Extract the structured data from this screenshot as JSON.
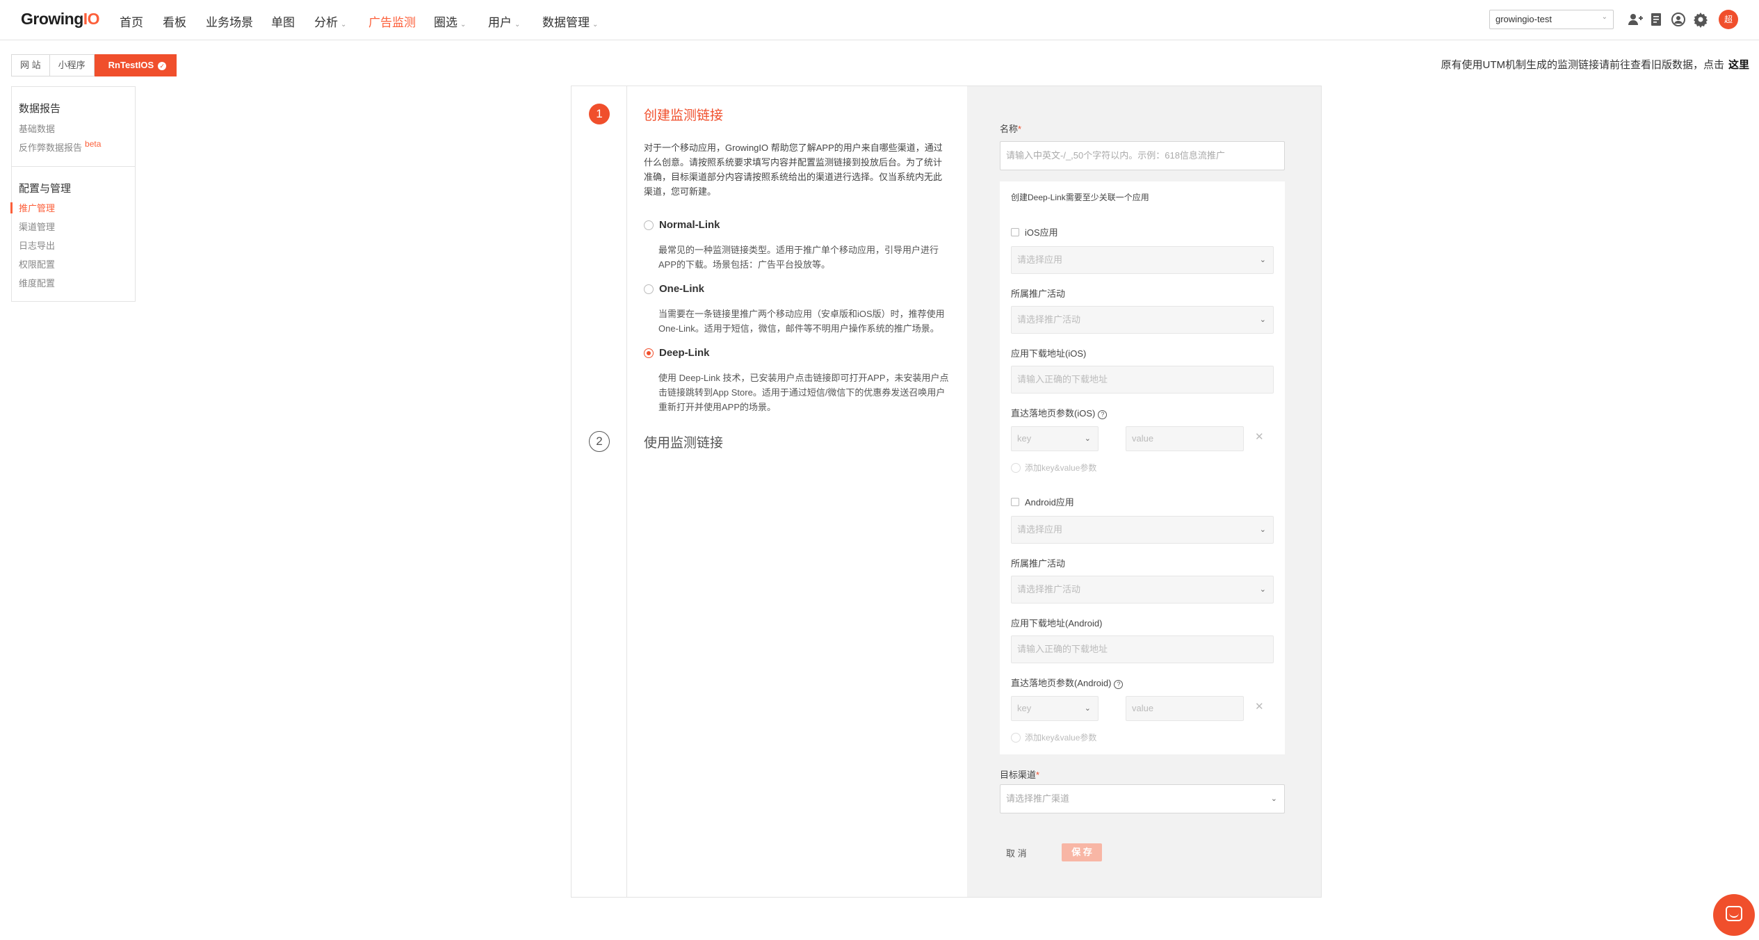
{
  "brand": {
    "logo_text": "Growing",
    "logo_accent": "IO",
    "accent_color": "#f04f2c"
  },
  "nav": {
    "items": [
      {
        "label": "首页",
        "has_caret": false
      },
      {
        "label": "看板",
        "has_caret": false
      },
      {
        "label": "业务场景",
        "has_caret": false
      },
      {
        "label": "单图",
        "has_caret": false
      },
      {
        "label": "分析",
        "has_caret": true
      },
      {
        "label": "广告监测",
        "has_caret": false,
        "active": true
      },
      {
        "label": "圈选",
        "has_caret": true
      },
      {
        "label": "用户",
        "has_caret": true
      },
      {
        "label": "数据管理",
        "has_caret": true
      }
    ],
    "project_select": "growingio-test",
    "tools": [
      "add-user-icon",
      "document-icon",
      "eye-icon",
      "gear-icon"
    ],
    "user_avatar": "超"
  },
  "platform_tabs": {
    "items": [
      "网 站",
      "小程序",
      "RnTestIOS"
    ],
    "active_index": 2
  },
  "notice": {
    "text": "原有使用UTM机制生成的监测链接请前往查看旧版数据，点击",
    "link": "这里"
  },
  "sidebar": {
    "section1_title": "数据报告",
    "section1_items": [
      "基础数据",
      "反作弊数据报告"
    ],
    "beta": "beta",
    "section2_title": "配置与管理",
    "section2_items": [
      "推广管理",
      "渠道管理",
      "日志导出",
      "权限配置",
      "维度配置"
    ],
    "active_item": "推广管理"
  },
  "steps": {
    "step1": {
      "num": "1",
      "title": "创建监测链接"
    },
    "step2": {
      "num": "2",
      "title": "使用监测链接"
    },
    "intro": "对于一个移动应用，GrowingIO 帮助您了解APP的用户来自哪些渠道，通过什么创意。请按照系统要求填写内容并配置监测链接到投放后台。为了统计准确，目标渠道部分内容请按照系统给出的渠道进行选择。仅当系统内无此渠道，您可新建。",
    "options": [
      {
        "label": "Normal-Link",
        "desc": "最常见的一种监测链接类型。适用于推广单个移动应用，引导用户进行APP的下载。场景包括：广告平台投放等。",
        "checked": false
      },
      {
        "label": "One-Link",
        "desc": "当需要在一条链接里推广两个移动应用（安卓版和iOS版）时，推荐使用One-Link。适用于短信，微信，邮件等不明用户操作系统的推广场景。",
        "checked": false
      },
      {
        "label": "Deep-Link",
        "desc": "使用 Deep-Link 技术，已安装用户点击链接即可打开APP，未安装用户点击链接跳转到App Store。适用于通过短信/微信下的优惠券发送召唤用户重新打开并使用APP的场景。",
        "checked": true
      }
    ]
  },
  "form": {
    "name_label": "名称",
    "name_placeholder": "请输入中英文-/_,50个字符以内。示例：618信息流推广",
    "deeplink_hint": "创建Deep-Link需要至少关联一个应用",
    "ios": {
      "checkbox_label": "iOS应用",
      "app_placeholder": "请选择应用",
      "campaign_label": "所属推广活动",
      "campaign_placeholder": "请选择推广活动",
      "download_label": "应用下载地址(iOS)",
      "download_placeholder": "请输入正确的下载地址",
      "param_label": "直达落地页参数(iOS)",
      "key_placeholder": "key",
      "value_placeholder": "value",
      "add_param": "添加key&value参数"
    },
    "android": {
      "checkbox_label": "Android应用",
      "app_placeholder": "请选择应用",
      "campaign_label": "所属推广活动",
      "campaign_placeholder": "请选择推广活动",
      "download_label": "应用下载地址(Android)",
      "download_placeholder": "请输入正确的下载地址",
      "param_label": "直达落地页参数(Android)",
      "key_placeholder": "key",
      "value_placeholder": "value",
      "add_param": "添加key&value参数"
    },
    "channel_label": "目标渠道",
    "channel_placeholder": "请选择推广渠道",
    "required_mark": "*",
    "cancel": "取 消",
    "save": "保 存"
  }
}
